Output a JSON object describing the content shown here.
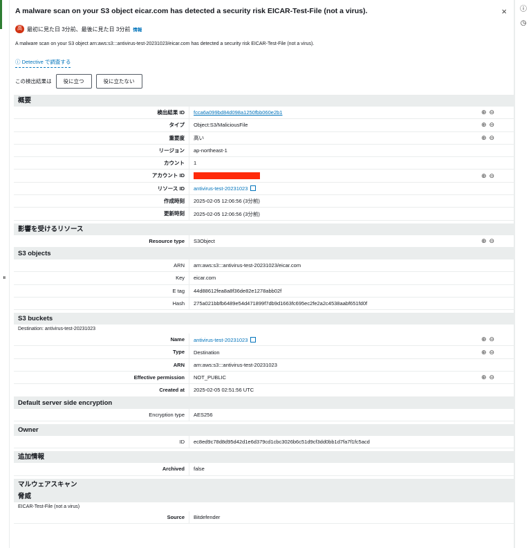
{
  "header": {
    "title": "A malware scan on your S3 object eicar.com has detected a security risk EICAR-Test-File (not a virus).",
    "close_glyph": "×"
  },
  "severity": {
    "badge": "高",
    "seen_text": "最初に見た日 3分前、最後に見た日 3分前",
    "info_label": "情報",
    "color": "#d13212"
  },
  "description": "A malware scan on your S3 object arn:aws:s3:::antivirus-test-20231023/eicar.com has detected a security risk EICAR-Test-File (not a virus).",
  "detective_link": "ⓘ Detective で調査する",
  "feedback": {
    "prompt": "この検出結果は",
    "useful": "役に立つ",
    "not_useful": "役に立たない"
  },
  "sections": {
    "overview": "概要",
    "affected": "影響を受けるリソース",
    "s3_objects": "S3 objects",
    "s3_buckets": "S3 buckets",
    "buckets_note": "Destination: antivirus-test-20231023",
    "encryption": "Default server side encryption",
    "owner": "Owner",
    "additional": "追加情報",
    "malware": "マルウェアスキャン",
    "threat": "脅威",
    "threat_note": "EICAR-Test-File (not a virus)"
  },
  "overview": [
    {
      "k": "検出結果 ID",
      "v": "fcca6a099bd84d098a1250fbb060e2b1"
    },
    {
      "k": "タイプ",
      "v": "Object:S3/MaliciousFile"
    },
    {
      "k": "重要度",
      "v": "高い"
    },
    {
      "k": "リージョン",
      "v": "ap-northeast-1"
    },
    {
      "k": "カウント",
      "v": "1"
    },
    {
      "k": "アカウント ID",
      "v": ""
    },
    {
      "k": "リソース ID",
      "v": "antivirus-test-20231023"
    },
    {
      "k": "作成時刻",
      "v": "2025-02-05 12:06:56 (3分前)"
    },
    {
      "k": "更新時刻",
      "v": "2025-02-05 12:06:56 (3分前)"
    }
  ],
  "affected": [
    {
      "k": "Resource type",
      "v": "S3Object"
    }
  ],
  "s3_objects": [
    {
      "k": "ARN",
      "v": "arn:aws:s3:::antivirus-test-20231023/eicar.com"
    },
    {
      "k": "Key",
      "v": "eicar.com"
    },
    {
      "k": "E tag",
      "v": "44d88612fea8a8f36de82e1278abb02f"
    },
    {
      "k": "Hash",
      "v": "275a021bbfb6489e54d471899f7db9d1663fc695ec2fe2a2c4538aabf651fd0f"
    }
  ],
  "s3_buckets": [
    {
      "k": "Name",
      "v": "antivirus-test-20231023"
    },
    {
      "k": "Type",
      "v": "Destination"
    },
    {
      "k": "ARN",
      "v": "arn:aws:s3:::antivirus-test-20231023"
    },
    {
      "k": "Effective permission",
      "v": "NOT_PUBLIC"
    },
    {
      "k": "Created at",
      "v": "2025-02-05 02:51:56 UTC"
    }
  ],
  "encryption": [
    {
      "k": "Encryption type",
      "v": "AES256"
    }
  ],
  "owner": [
    {
      "k": "ID",
      "v": "ec8ed9c78d8d95d42d1e6d379cd1cbc3026b6c51d9cf3dd0bb1d7fa7f1fc5acd"
    }
  ],
  "additional": [
    {
      "k": "Archived",
      "v": "false"
    }
  ],
  "threat": [
    {
      "k": "Source",
      "v": "Bitdefender"
    }
  ],
  "icons": {
    "zoom_in": "⊕",
    "zoom_out": "⊖",
    "info": "ⓘ",
    "clock": "◷",
    "grip": "⏸"
  }
}
